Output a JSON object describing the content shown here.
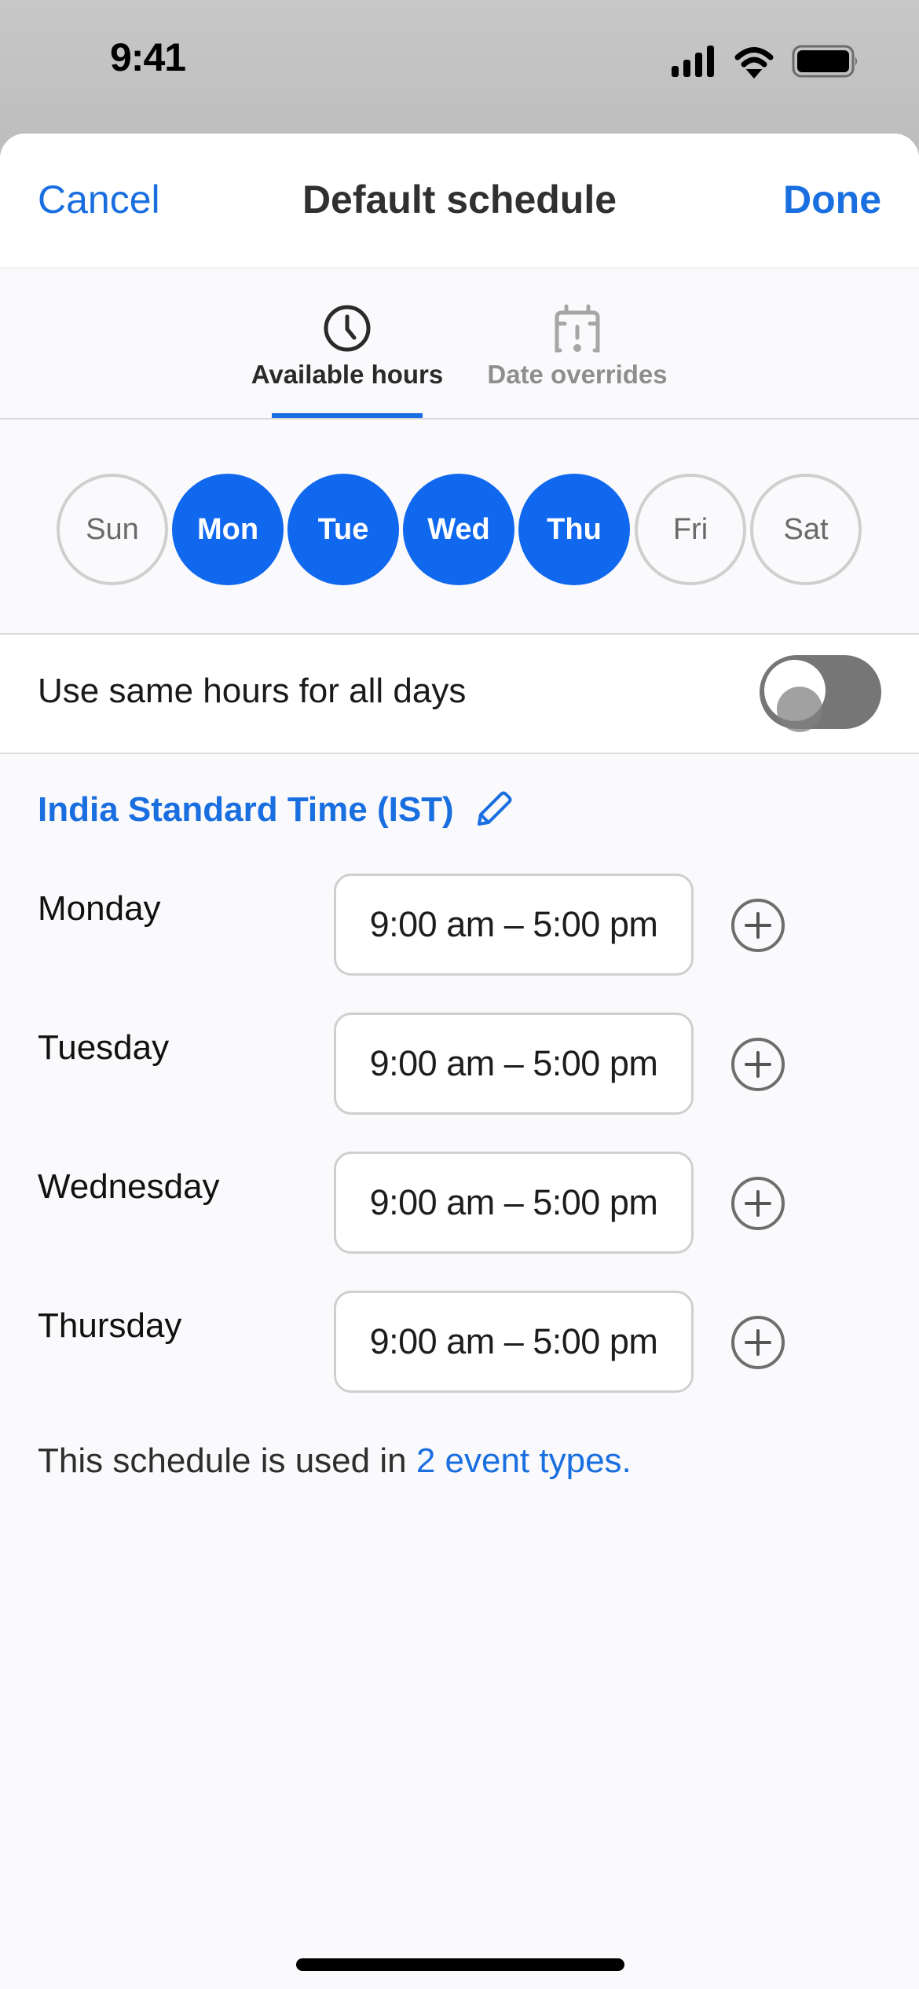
{
  "status_bar": {
    "time": "9:41",
    "icons": [
      "cellular-signal-icon",
      "wifi-icon",
      "battery-icon"
    ]
  },
  "nav": {
    "cancel_label": "Cancel",
    "title": "Default schedule",
    "done_label": "Done"
  },
  "tabs": [
    {
      "label": "Available hours",
      "icon": "clock-icon",
      "active": true
    },
    {
      "label": "Date overrides",
      "icon": "calendar-alert-icon",
      "active": false
    }
  ],
  "days": [
    {
      "label": "Sun",
      "selected": false
    },
    {
      "label": "Mon",
      "selected": true
    },
    {
      "label": "Tue",
      "selected": true
    },
    {
      "label": "Wed",
      "selected": true
    },
    {
      "label": "Thu",
      "selected": true
    },
    {
      "label": "Fri",
      "selected": false
    },
    {
      "label": "Sat",
      "selected": false
    }
  ],
  "same_hours": {
    "label": "Use same hours for all days",
    "enabled": false
  },
  "timezone": {
    "label": "India Standard Time (IST)",
    "edit_icon": "pencil-icon"
  },
  "hours": [
    {
      "day": "Monday",
      "range": "9:00 am – 5:00 pm"
    },
    {
      "day": "Tuesday",
      "range": "9:00 am – 5:00 pm"
    },
    {
      "day": "Wednesday",
      "range": "9:00 am – 5:00 pm"
    },
    {
      "day": "Thursday",
      "range": "9:00 am – 5:00 pm"
    }
  ],
  "footer": {
    "prefix": "This schedule is used in ",
    "link": "2 event types."
  },
  "colors": {
    "accent": "#1a6fe0",
    "day_selected": "#1068ee",
    "toggle_off": "#767676",
    "background": "#faf9fc"
  }
}
